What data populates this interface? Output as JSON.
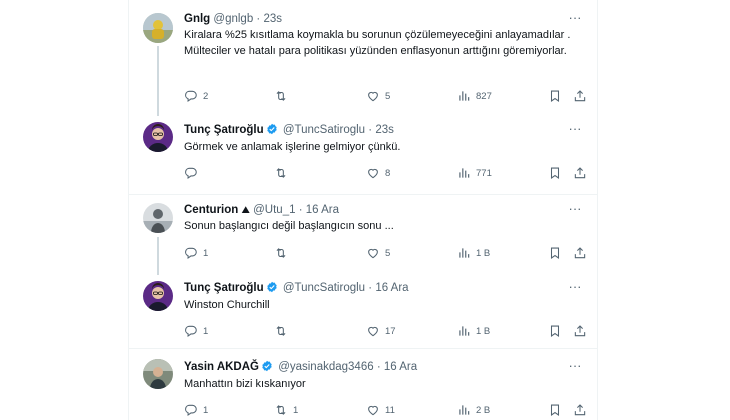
{
  "tweets": [
    {
      "name": "Gnlg",
      "handle": "@gnlgb",
      "sep": "·",
      "time": "23s",
      "text": "Kiralara %25 kısıtlama koymakla bu sorunun çözülemeyeceğini anlayamadılar . Mülteciler ve hatalı para politikası yüzünden enflasyonun arttığını göremiyorlar.",
      "replies": "2",
      "retweets": "",
      "likes": "5",
      "views": "827",
      "verified": false
    },
    {
      "name": "Tunç Şatıroğlu",
      "handle": "@TuncSatiroglu",
      "sep": "·",
      "time": "23s",
      "text": "Görmek ve anlamak işlerine gelmiyor çünkü.",
      "replies": "",
      "retweets": "",
      "likes": "8",
      "views": "771",
      "verified": true
    },
    {
      "name": "Centurion",
      "name_emoji": "⛰",
      "handle": "@Utu_1",
      "sep": "·",
      "time": "16 Ara",
      "text": "Sonun başlangıcı değil başlangıcın sonu ...",
      "replies": "1",
      "retweets": "",
      "likes": "5",
      "views": "1 B",
      "verified": false
    },
    {
      "name": "Tunç Şatıroğlu",
      "handle": "@TuncSatiroglu",
      "sep": "·",
      "time": "16 Ara",
      "text": "Winston Churchill",
      "replies": "1",
      "retweets": "",
      "likes": "17",
      "views": "1 B",
      "verified": true
    },
    {
      "name": "Yasin AKDAĞ",
      "handle": "@yasinakdag3466",
      "sep": "·",
      "time": "16 Ara",
      "text": "Manhattın bizi kıskanıyor",
      "replies": "1",
      "retweets": "1",
      "likes": "11",
      "views": "2 B",
      "verified": true
    }
  ],
  "more_glyph": "···",
  "colors": {
    "accent": "#1d9bf0",
    "muted": "#536471",
    "text": "#0f1419",
    "border": "#eff3f4"
  }
}
